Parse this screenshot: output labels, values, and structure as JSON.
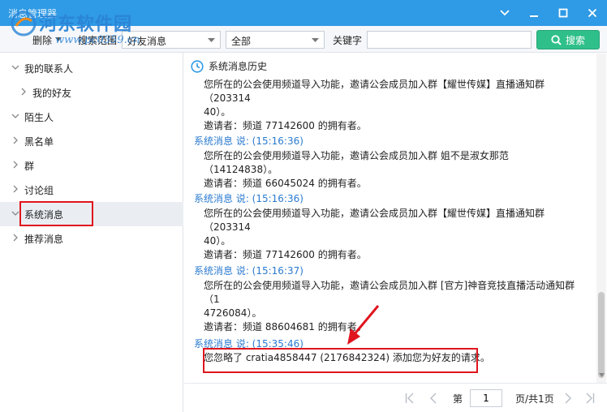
{
  "window": {
    "title": "消息管理器"
  },
  "watermark": {
    "site_name": "河东软件园",
    "site_url": "www.pc0359.cn"
  },
  "toolbar": {
    "delete_label": "删除",
    "scope_label": "搜索范围",
    "scope_select": "好友消息",
    "range_select": "全部",
    "keyword_label": "关键字",
    "keyword_value": "",
    "search_label": "搜索"
  },
  "sidebar": {
    "items": [
      {
        "label": "我的联系人",
        "expanded": true
      },
      {
        "label": "我的好友",
        "expanded": false
      },
      {
        "label": "陌生人",
        "expanded": true
      },
      {
        "label": "黑名单",
        "expanded": false
      },
      {
        "label": "群",
        "expanded": false
      },
      {
        "label": "讨论组",
        "expanded": false
      },
      {
        "label": "系统消息",
        "expanded": true,
        "selected": true
      },
      {
        "label": "推荐消息",
        "expanded": false
      }
    ]
  },
  "main": {
    "history_title": "系统消息历史",
    "messages": [
      {
        "meta": "",
        "text": "您所在的公会使用频道导入功能，邀请公会成员加入群【耀世传媒】直播通知群（20331440）。",
        "inviter": "邀请者：频道 77142600 的拥有者。"
      },
      {
        "meta": "系统消息 说: (15:16:36)",
        "text": "您所在的公会使用频道导入功能，邀请公会成员加入群 姐不是淑女那范（14124838）。",
        "inviter": "邀请者：频道 66045024 的拥有者。"
      },
      {
        "meta": "系统消息 说: (15:16:36)",
        "text": "您所在的公会使用频道导入功能，邀请公会成员加入群【耀世传媒】直播通知群（20331440）。",
        "inviter": "邀请者：频道 77142600 的拥有者。"
      },
      {
        "meta": "系统消息 说: (15:16:37)",
        "text": "您所在的公会使用频道导入功能，邀请公会成员加入群 [官方]神音竞技直播活动通知群（14726084）。",
        "inviter": "邀请者：频道 88604681 的拥有者。"
      },
      {
        "meta": "系统消息 说: (15:35:46)",
        "text": "您忽略了 cratia4858447 (2176842324) 添加您为好友的请求。",
        "inviter": ""
      }
    ],
    "msg0_line1": "您所在的公会使用频道导入功能，邀请公会成员加入群【耀世传媒】直播通知群（203314",
    "msg0_line2": "40）。",
    "msg1_line1": "您所在的公会使用频道导入功能，邀请公会成员加入群 姐不是淑女那范（14124838）。",
    "msg2_line1": "您所在的公会使用频道导入功能，邀请公会成员加入群【耀世传媒】直播通知群（203314",
    "msg2_line2": "40）。",
    "msg3_line1": "您所在的公会使用频道导入功能，邀请公会成员加入群 [官方]神音竞技直播活动通知群（1",
    "msg3_line2": "4726084）。"
  },
  "pager": {
    "page_label": "第",
    "page_value": "1",
    "total_label": "页/共1页"
  },
  "colors": {
    "titlebar": "#2f9ae5",
    "accent_green": "#2fbf8a",
    "meta_blue": "#2b7bd0",
    "highlight_red": "#e0141e"
  }
}
